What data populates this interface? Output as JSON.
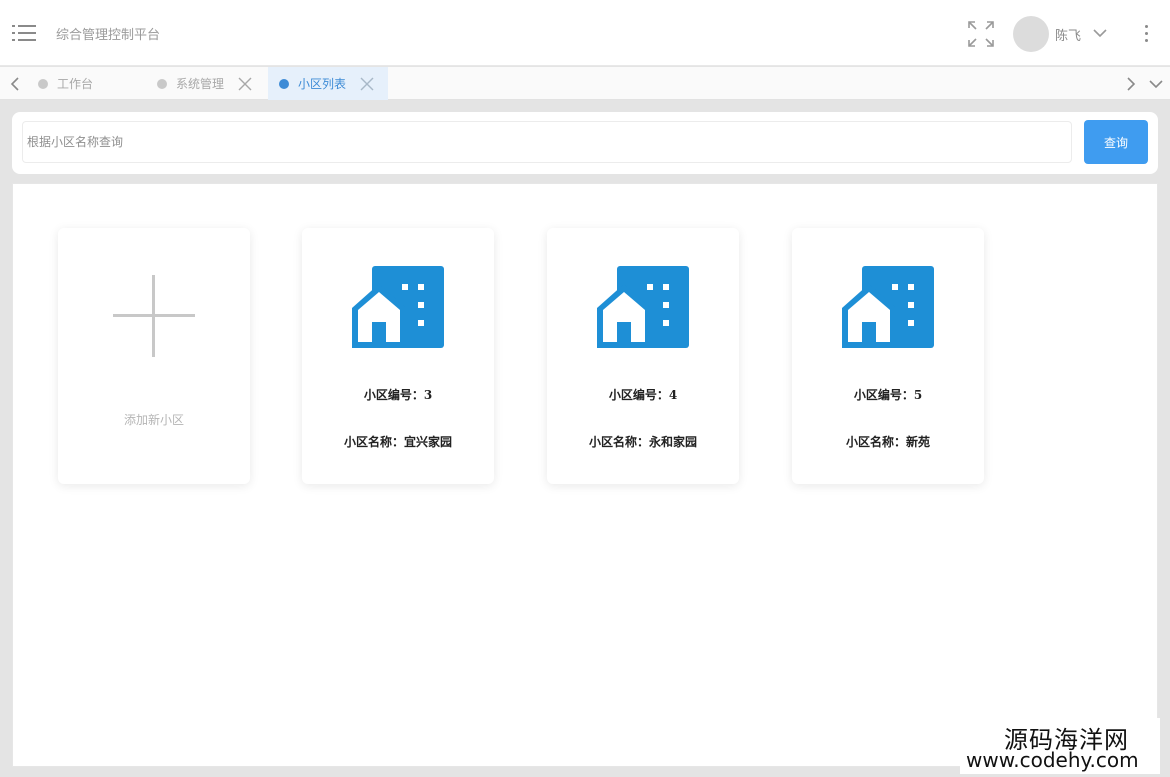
{
  "header": {
    "app_title": "综合管理控制平台",
    "user": {
      "name": "陈飞"
    }
  },
  "tabs": [
    {
      "label": "工作台",
      "active": false,
      "closable": false
    },
    {
      "label": "系统管理",
      "active": false,
      "closable": true
    },
    {
      "label": "小区列表",
      "active": true,
      "closable": true
    }
  ],
  "search": {
    "placeholder": "根据小区名称查询",
    "value": "",
    "button_label": "查询"
  },
  "add_card": {
    "label": "添加新小区",
    "icon": "plus-icon"
  },
  "communities": [
    {
      "code_line": "小区编号：3",
      "name_line": "小区名称：宜兴家园",
      "icon": "building-icon"
    },
    {
      "code_line": "小区编号：4",
      "name_line": "小区名称：永和家园",
      "icon": "building-icon"
    },
    {
      "code_line": "小区编号：5",
      "name_line": "小区名称：新苑",
      "icon": "building-icon"
    }
  ],
  "colors": {
    "accent": "#3f9cf0",
    "icon_blue": "#1e8fd6",
    "active_tab_text": "#3d8bd6",
    "active_tab_bg": "#e6f0fb"
  },
  "watermark": {
    "text": "源码海洋网",
    "url": "www.codehy.com"
  }
}
